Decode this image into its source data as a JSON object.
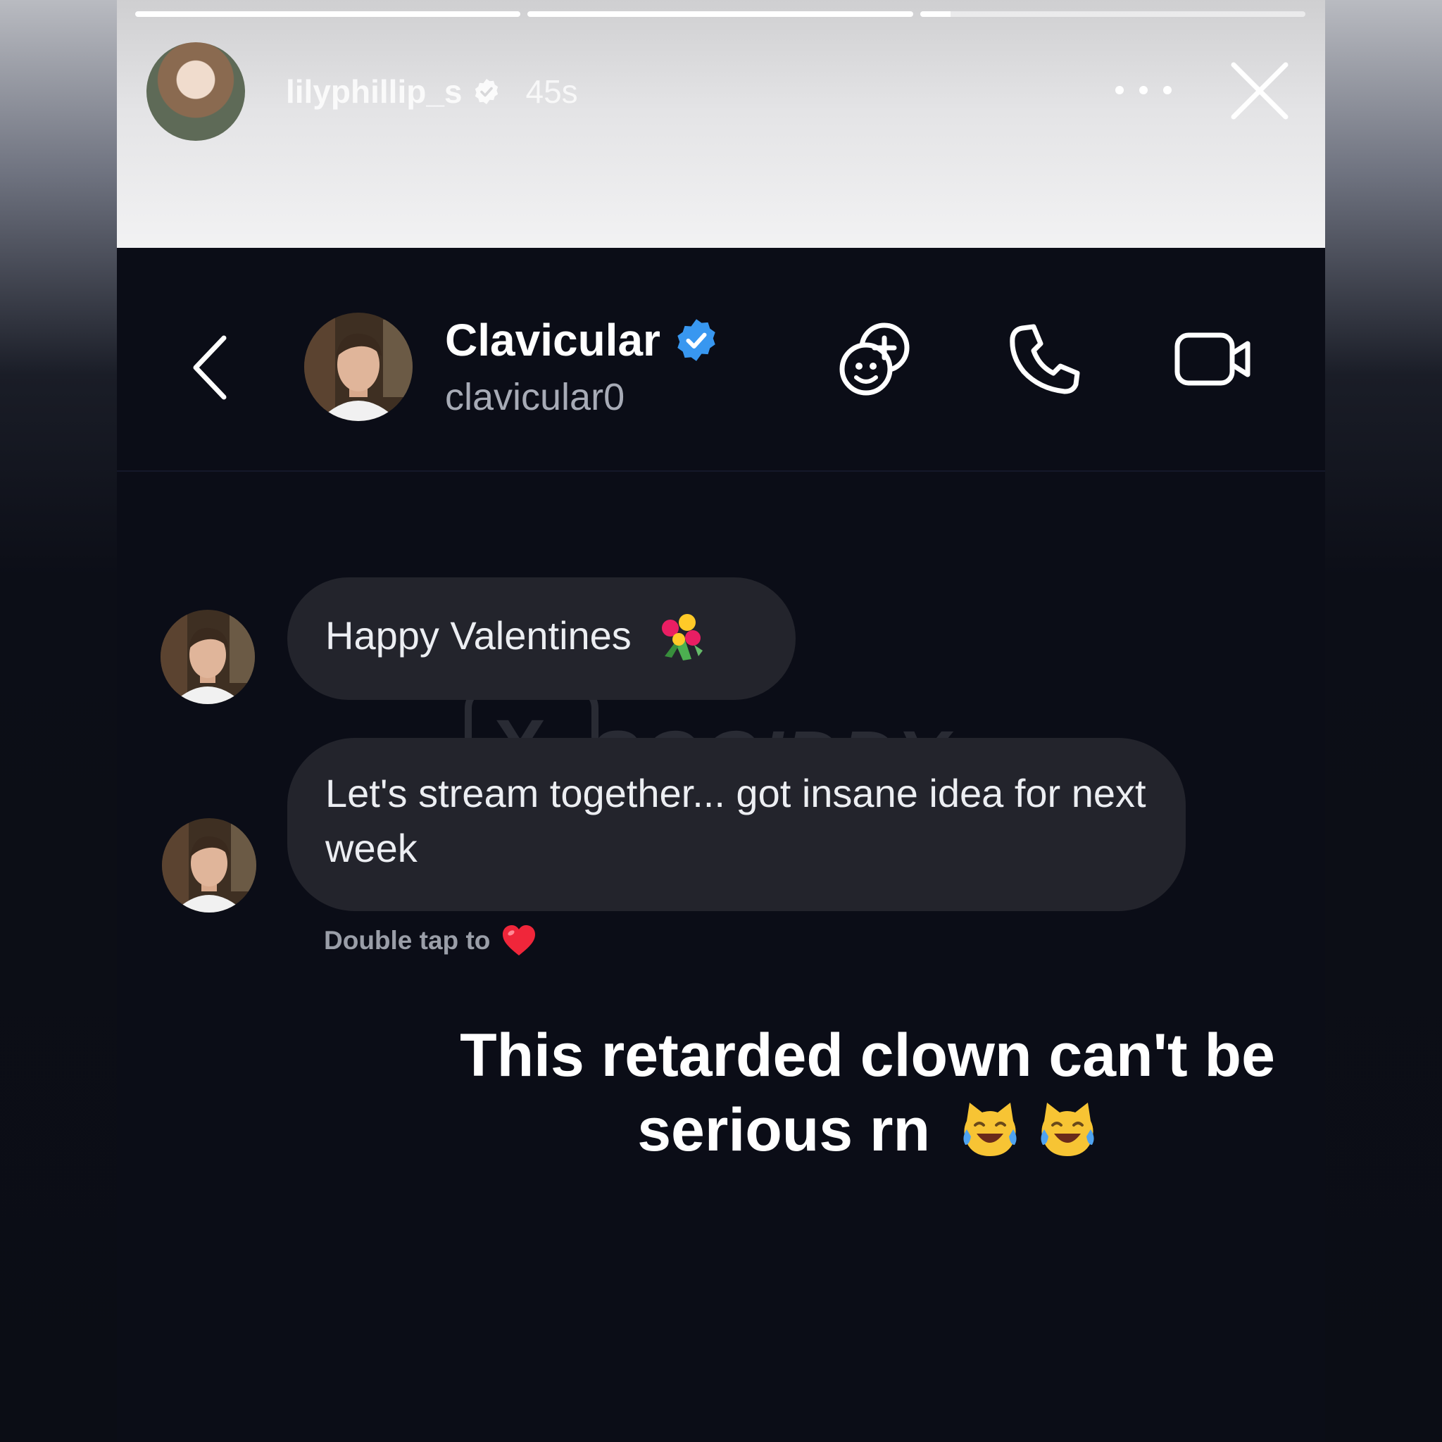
{
  "story": {
    "progress_segments": [
      1,
      1,
      0.08
    ],
    "username": "lilyphillip_s",
    "time": "45s",
    "icons": {
      "verified": "verified-check-icon",
      "more": "more-dots-icon",
      "close": "close-icon"
    }
  },
  "dm": {
    "name": "Clavicular",
    "handle": "clavicular0",
    "icons": {
      "back": "back-chevron-icon",
      "effects": "effects-face-plus-icon",
      "call": "phone-icon",
      "video": "video-camera-icon",
      "verified": "verified-badge-icon"
    },
    "verified_color": "#3897f0"
  },
  "messages": [
    {
      "text": "Happy Valentines",
      "emoji": "bouquet-emoji"
    },
    {
      "text": "Let's stream together... got insane idea for next week"
    }
  ],
  "reaction_hint": {
    "text": "Double tap to",
    "icon": "red-heart-emoji"
  },
  "watermark": {
    "letter": "X",
    "text": "SOGIDDY"
  },
  "caption": {
    "text": "This retarded clown can't be serious rn",
    "emoji": "crying-laughing-cat-emoji"
  }
}
